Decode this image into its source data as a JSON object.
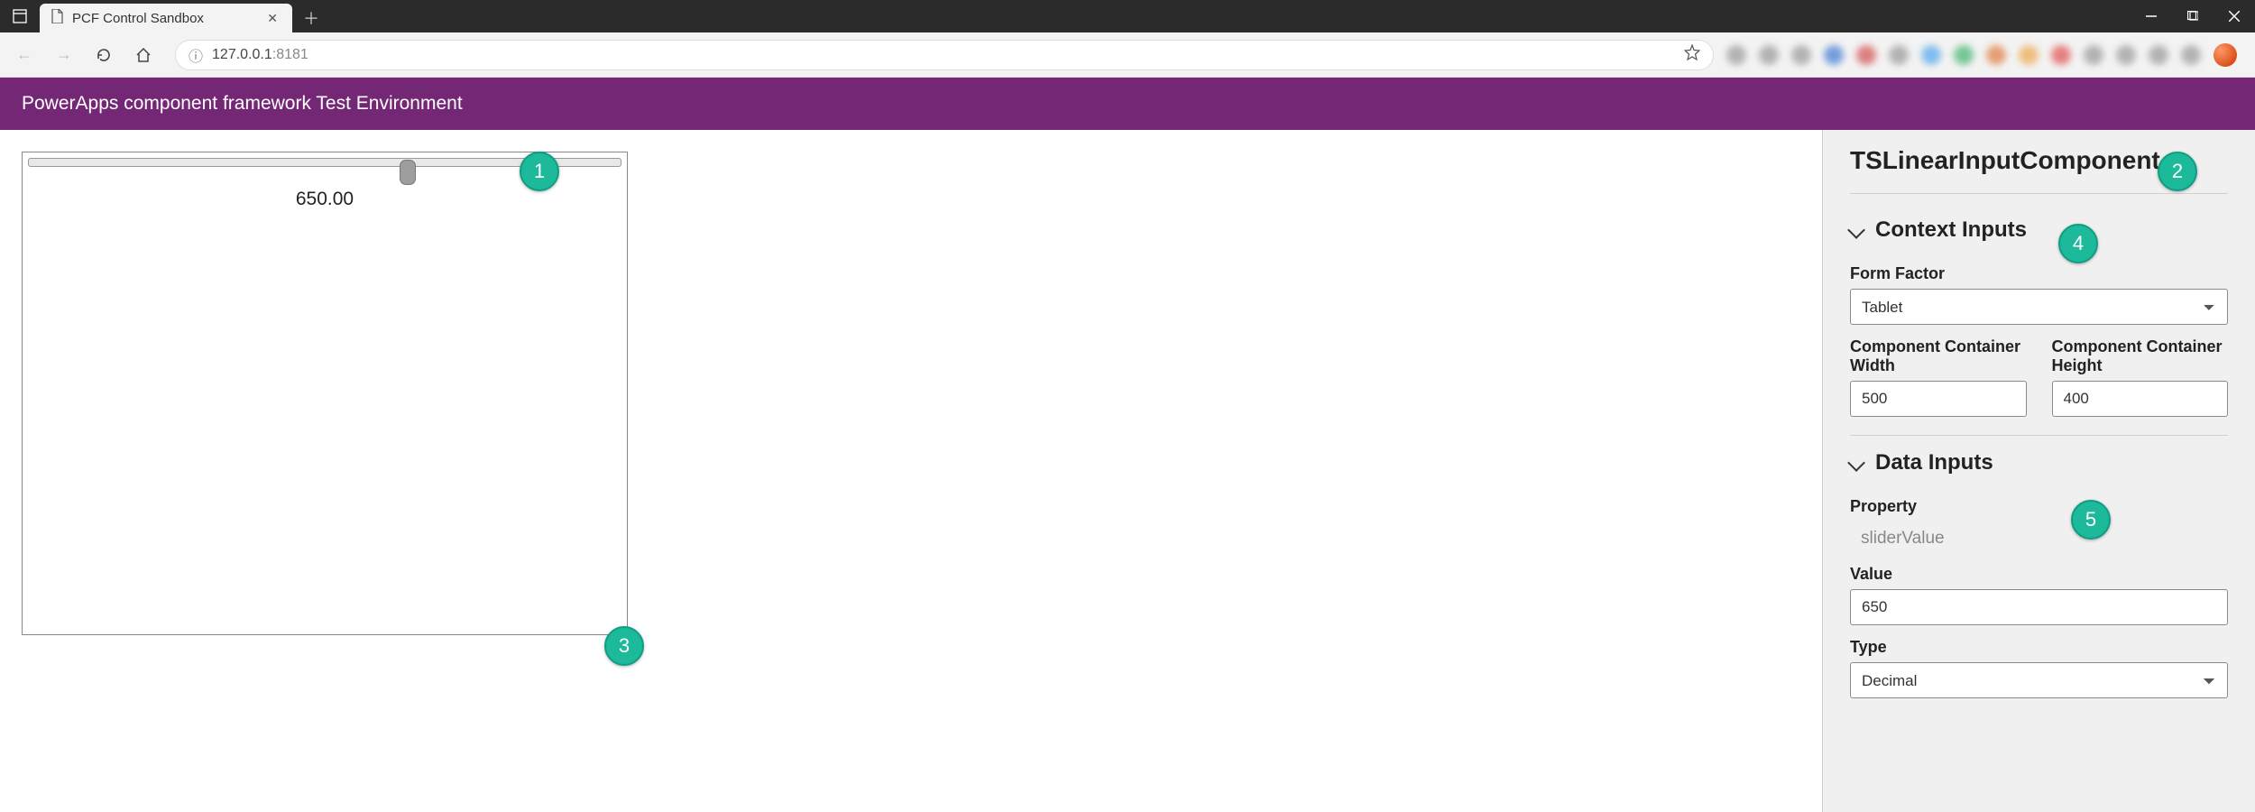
{
  "browser": {
    "tab_title": "PCF Control Sandbox",
    "url_display": "127.0.0.1:8181",
    "url_port_hint": "8181"
  },
  "env_header": "PowerApps component framework Test Environment",
  "component": {
    "slider_display": "650.00"
  },
  "panel": {
    "component_name": "TSLinearInputComponent",
    "sections": {
      "context": {
        "title": "Context Inputs",
        "form_factor_label": "Form Factor",
        "form_factor_value": "Tablet",
        "width_label": "Component Container Width",
        "width_value": "500",
        "height_label": "Component Container Height",
        "height_value": "400"
      },
      "data": {
        "title": "Data Inputs",
        "property_label": "Property",
        "property_name": "sliderValue",
        "value_label": "Value",
        "value_value": "650",
        "type_label": "Type",
        "type_value": "Decimal"
      }
    }
  },
  "callouts": {
    "c1": "1",
    "c2": "2",
    "c3": "3",
    "c4": "4",
    "c5": "5"
  }
}
